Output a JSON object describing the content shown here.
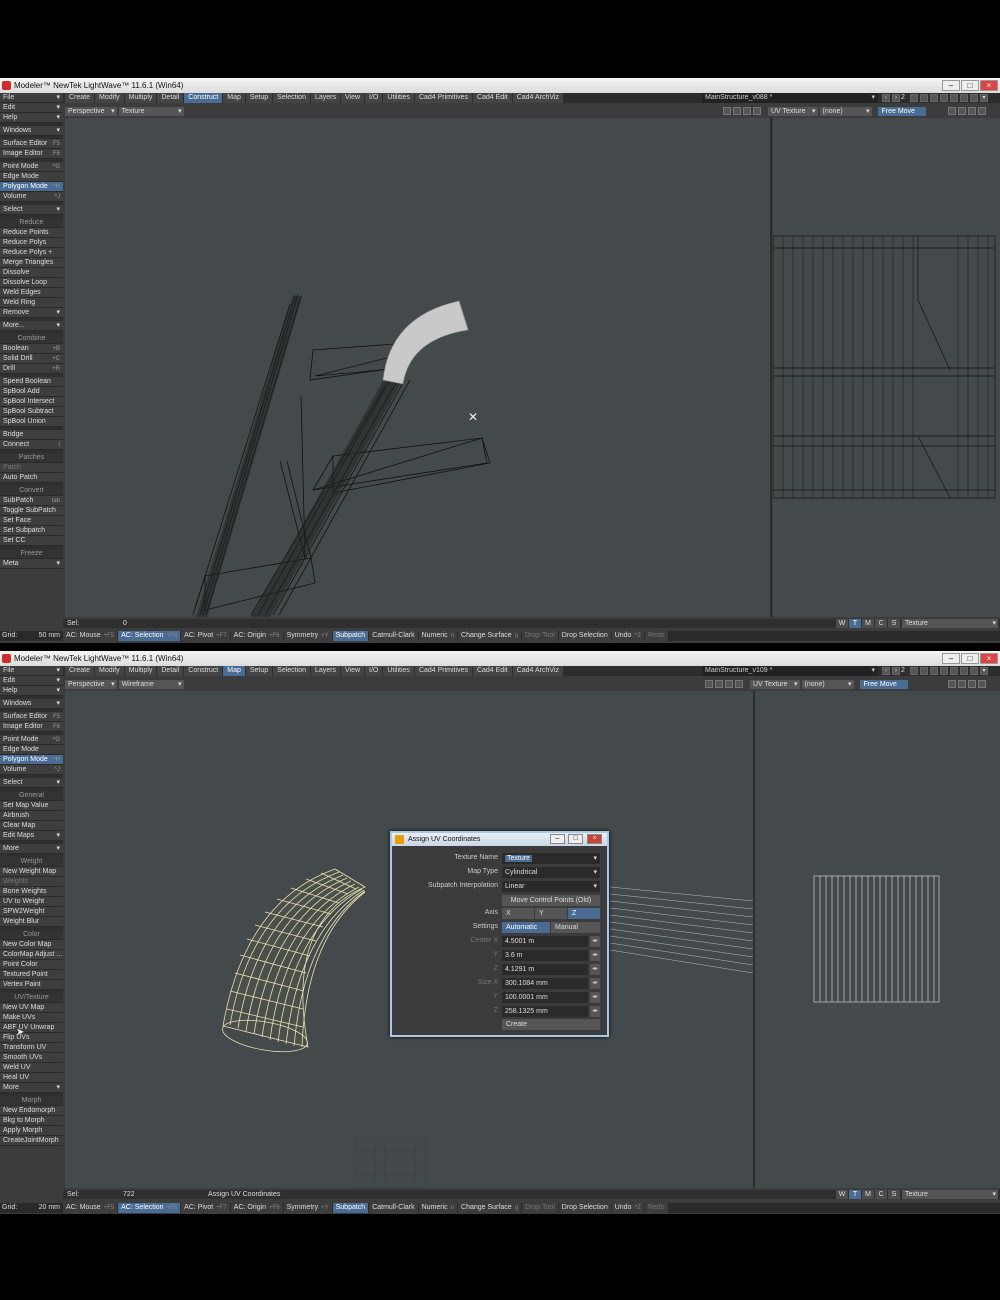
{
  "window1": {
    "title": "Modeler™ NewTek LightWave™ 11.6.1 (Win64)",
    "tabs": [
      "Create",
      "Modify",
      "Multiply",
      "Detail",
      "Construct",
      "Map",
      "Setup",
      "Selection",
      "Layers",
      "View",
      "I/O",
      "Utilities",
      "Cad4 Primitives",
      "Cad4 Edit",
      "Cad4 ArchViz"
    ],
    "active_tab": "Construct",
    "scene": "MainStructure_v088 *",
    "layer_num": "2",
    "viewport_left": {
      "view": "Perspective",
      "shading": "Texture"
    },
    "viewport_right": {
      "uv": "UV Texture",
      "map": "(none)",
      "move": "Free Move"
    },
    "sidebar": [
      {
        "t": "item",
        "label": "File",
        "dd": true
      },
      {
        "t": "item",
        "label": "Edit",
        "dd": true
      },
      {
        "t": "item",
        "label": "Help",
        "dd": true
      },
      {
        "t": "gap"
      },
      {
        "t": "item",
        "label": "Windows",
        "dd": true
      },
      {
        "t": "gap"
      },
      {
        "t": "item",
        "label": "Surface Editor",
        "sc": "F5"
      },
      {
        "t": "item",
        "label": "Image Editor",
        "sc": "F6"
      },
      {
        "t": "gap"
      },
      {
        "t": "item",
        "label": "Point Mode",
        "sc": "^G"
      },
      {
        "t": "item",
        "label": "Edge Mode",
        "sc": ""
      },
      {
        "t": "item",
        "label": "Polygon Mode",
        "sc": "^H",
        "active": true
      },
      {
        "t": "item",
        "label": "Volume",
        "sc": "^J"
      },
      {
        "t": "gap"
      },
      {
        "t": "item",
        "label": "Select",
        "dd": true
      },
      {
        "t": "gap"
      },
      {
        "t": "header",
        "label": "Reduce"
      },
      {
        "t": "item",
        "label": "Reduce Points"
      },
      {
        "t": "item",
        "label": "Reduce Polys"
      },
      {
        "t": "item",
        "label": "Reduce Polys +"
      },
      {
        "t": "item",
        "label": "Merge Triangles"
      },
      {
        "t": "item",
        "label": "Dissolve"
      },
      {
        "t": "item",
        "label": "Dissolve Loop"
      },
      {
        "t": "item",
        "label": "Weld Edges"
      },
      {
        "t": "item",
        "label": "Weld Ring"
      },
      {
        "t": "item",
        "label": "Remove",
        "dd": true
      },
      {
        "t": "gap"
      },
      {
        "t": "item",
        "label": "More...",
        "dd": true
      },
      {
        "t": "gap"
      },
      {
        "t": "header",
        "label": "Combine"
      },
      {
        "t": "item",
        "label": "Boolean",
        "sc": "+B"
      },
      {
        "t": "item",
        "label": "Solid Drill",
        "sc": "+C"
      },
      {
        "t": "item",
        "label": "Drill",
        "sc": "+R"
      },
      {
        "t": "gap"
      },
      {
        "t": "item",
        "label": "Speed Boolean"
      },
      {
        "t": "item",
        "label": "SpBool Add"
      },
      {
        "t": "item",
        "label": "SpBool Intersect"
      },
      {
        "t": "item",
        "label": "SpBool Subtract"
      },
      {
        "t": "item",
        "label": "SpBool Union"
      },
      {
        "t": "gap"
      },
      {
        "t": "item",
        "label": "Bridge"
      },
      {
        "t": "item",
        "label": "Connect",
        "sc": "I"
      },
      {
        "t": "gap"
      },
      {
        "t": "header",
        "label": "Patches"
      },
      {
        "t": "item",
        "label": "Patch",
        "disabled": true
      },
      {
        "t": "item",
        "label": "Auto Patch"
      },
      {
        "t": "gap"
      },
      {
        "t": "header",
        "label": "Convert"
      },
      {
        "t": "item",
        "label": "SubPatch",
        "sc": "tab"
      },
      {
        "t": "item",
        "label": "Toggle SubPatch"
      },
      {
        "t": "item",
        "label": "Set Face"
      },
      {
        "t": "item",
        "label": "Set Subpatch"
      },
      {
        "t": "item",
        "label": "Set CC"
      },
      {
        "t": "gap"
      },
      {
        "t": "header",
        "label": "Freeze"
      },
      {
        "t": "item",
        "label": "Meta",
        "dd": true
      }
    ],
    "status": {
      "sel_label": "Sel:",
      "sel_value": "0",
      "message": ""
    },
    "wmcs": [
      "W",
      "T",
      "M",
      "C",
      "S"
    ],
    "status_texture": "Texture",
    "bottom": {
      "grid_label": "Grid:",
      "grid_value": "50 mm",
      "buttons": [
        {
          "label": "AC: Mouse",
          "sc": "+F5"
        },
        {
          "label": "AC: Selection",
          "sc": "+F8",
          "on": true
        },
        {
          "label": "AC: Pivot",
          "sc": "+F7"
        },
        {
          "label": "AC: Origin",
          "sc": "+F6"
        },
        {
          "label": "Symmetry",
          "sc": "+Y"
        },
        {
          "label": "Subpatch",
          "sc": "",
          "on": true
        },
        {
          "label": "Catmull-Clark",
          "sc": ""
        },
        {
          "label": "Numeric",
          "sc": "n"
        },
        {
          "label": "Change Surface",
          "sc": "q"
        },
        {
          "label": "Drop Tool",
          "sc": "",
          "dis": true
        },
        {
          "label": "Drop Selection",
          "sc": ""
        },
        {
          "label": "Undo",
          "sc": "^Z"
        },
        {
          "label": "Redo",
          "sc": "",
          "dis": true
        }
      ]
    }
  },
  "window2": {
    "title": "Modeler™ NewTek LightWave™ 11.6.1 (Win64)",
    "tabs": [
      "Create",
      "Modify",
      "Multiply",
      "Detail",
      "Construct",
      "Map",
      "Setup",
      "Selection",
      "Layers",
      "View",
      "I/O",
      "Utilities",
      "Cad4 Primitives",
      "Cad4 Edit",
      "Cad4 ArchViz"
    ],
    "active_tab": "Map",
    "scene": "MainStructure_v109 *",
    "layer_num": "2",
    "viewport_left": {
      "view": "Perspective",
      "shading": "Wireframe"
    },
    "viewport_right": {
      "uv": "UV Texture",
      "map": "(none)",
      "move": "Free Move"
    },
    "sidebar": [
      {
        "t": "item",
        "label": "File",
        "dd": true
      },
      {
        "t": "item",
        "label": "Edit",
        "dd": true
      },
      {
        "t": "item",
        "label": "Help",
        "dd": true
      },
      {
        "t": "gap"
      },
      {
        "t": "item",
        "label": "Windows",
        "dd": true
      },
      {
        "t": "gap"
      },
      {
        "t": "item",
        "label": "Surface Editor",
        "sc": "F5"
      },
      {
        "t": "item",
        "label": "Image Editor",
        "sc": "F6"
      },
      {
        "t": "gap"
      },
      {
        "t": "item",
        "label": "Point Mode",
        "sc": "^G"
      },
      {
        "t": "item",
        "label": "Edge Mode",
        "sc": ""
      },
      {
        "t": "item",
        "label": "Polygon Mode",
        "sc": "^H",
        "active": true
      },
      {
        "t": "item",
        "label": "Volume",
        "sc": "^J"
      },
      {
        "t": "gap"
      },
      {
        "t": "item",
        "label": "Select",
        "dd": true
      },
      {
        "t": "gap"
      },
      {
        "t": "header",
        "label": "General"
      },
      {
        "t": "item",
        "label": "Set Map Value"
      },
      {
        "t": "item",
        "label": "Airbrush"
      },
      {
        "t": "item",
        "label": "Clear Map"
      },
      {
        "t": "item",
        "label": "Edit Maps",
        "dd": true
      },
      {
        "t": "gap"
      },
      {
        "t": "item",
        "label": "More",
        "dd": true
      },
      {
        "t": "gap"
      },
      {
        "t": "header",
        "label": "Weight"
      },
      {
        "t": "item",
        "label": "New Weight Map"
      },
      {
        "t": "item",
        "label": "Weights",
        "disabled": true
      },
      {
        "t": "item",
        "label": "Bone Weights"
      },
      {
        "t": "item",
        "label": "UV to Weight"
      },
      {
        "t": "item",
        "label": "SPW2Weight"
      },
      {
        "t": "item",
        "label": "Weight Blur"
      },
      {
        "t": "gap"
      },
      {
        "t": "header",
        "label": "Color"
      },
      {
        "t": "item",
        "label": "New Color Map"
      },
      {
        "t": "item",
        "label": "ColorMap Adjust ..."
      },
      {
        "t": "item",
        "label": "Point Color"
      },
      {
        "t": "item",
        "label": "Textured Point"
      },
      {
        "t": "item",
        "label": "Vertex Paint"
      },
      {
        "t": "gap"
      },
      {
        "t": "header",
        "label": "UV/Texture"
      },
      {
        "t": "item",
        "label": "New UV Map"
      },
      {
        "t": "item",
        "label": "Make UVs"
      },
      {
        "t": "item",
        "label": "ABF UV Unwrap"
      },
      {
        "t": "item",
        "label": "Flip UVs"
      },
      {
        "t": "item",
        "label": "Transform UV"
      },
      {
        "t": "item",
        "label": "Smooth UVs"
      },
      {
        "t": "item",
        "label": "Weld UV"
      },
      {
        "t": "item",
        "label": "Heal UV"
      },
      {
        "t": "item",
        "label": "More",
        "dd": true
      },
      {
        "t": "gap"
      },
      {
        "t": "header",
        "label": "Morph"
      },
      {
        "t": "item",
        "label": "New Endomorph"
      },
      {
        "t": "item",
        "label": "Bkg to Morph"
      },
      {
        "t": "item",
        "label": "Apply Morph"
      },
      {
        "t": "item",
        "label": "CreateJointMorph"
      }
    ],
    "status": {
      "sel_label": "Sel:",
      "sel_value": "722",
      "message": "Assign UV Coordinates"
    },
    "wmcs": [
      "W",
      "T",
      "M",
      "C",
      "S"
    ],
    "status_texture": "Texture",
    "bottom": {
      "grid_label": "Grid:",
      "grid_value": "20 mm",
      "buttons": [
        {
          "label": "AC: Mouse",
          "sc": "+F5"
        },
        {
          "label": "AC: Selection",
          "sc": "+F8",
          "on": true
        },
        {
          "label": "AC: Pivot",
          "sc": "+F7"
        },
        {
          "label": "AC: Origin",
          "sc": "+F6"
        },
        {
          "label": "Symmetry",
          "sc": "+Y"
        },
        {
          "label": "Subpatch",
          "sc": "",
          "on": true
        },
        {
          "label": "Catmull-Clark",
          "sc": ""
        },
        {
          "label": "Numeric",
          "sc": "n"
        },
        {
          "label": "Change Surface",
          "sc": "q"
        },
        {
          "label": "Drop Tool",
          "sc": "",
          "dis": true
        },
        {
          "label": "Drop Selection",
          "sc": ""
        },
        {
          "label": "Undo",
          "sc": "^Z"
        },
        {
          "label": "Redo",
          "sc": "",
          "dis": true
        }
      ]
    }
  },
  "dialog": {
    "title": "Assign UV Coordinates",
    "texture_name_label": "Texture Name",
    "texture_name_value": "Texture",
    "map_type_label": "Map Type",
    "map_type_value": "Cylindrical",
    "interp_label": "Subpatch Interpolation",
    "interp_value": "Linear",
    "move_cp_label": "Move Control Points (Old)",
    "axis_label": "Axis",
    "axis_options": [
      "X",
      "Y",
      "Z"
    ],
    "axis_selected": "Z",
    "settings_label": "Settings",
    "settings_options": [
      "Automatic",
      "Manual"
    ],
    "settings_selected": "Automatic",
    "center_x_label": "Center X",
    "center_x": "4.5001 m",
    "center_y_label": "Y",
    "center_y": "3.6 m",
    "center_z_label": "Z",
    "center_z": "4.1291 m",
    "size_x_label": "Size X",
    "size_x": "300.1084 mm",
    "size_y_label": "Y",
    "size_y": "100.0001 mm",
    "size_z_label": "Z",
    "size_z": "258.1325 mm",
    "create_label": "Create"
  }
}
